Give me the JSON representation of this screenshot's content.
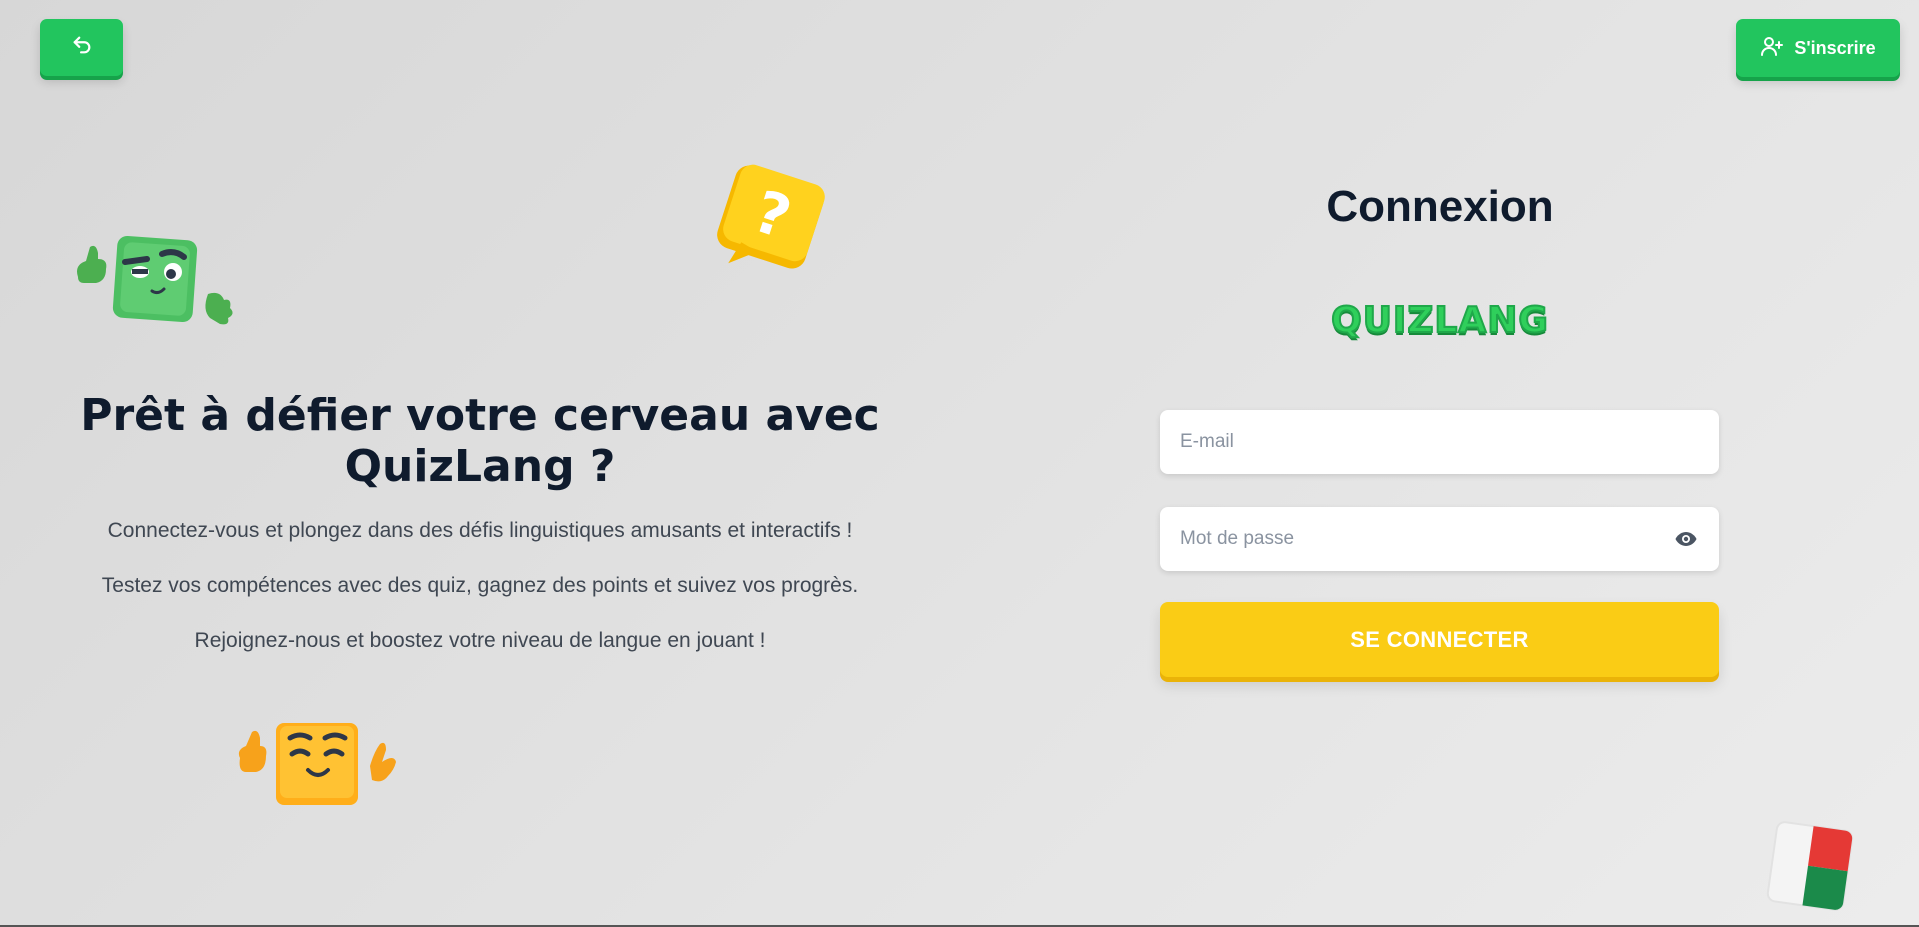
{
  "header": {
    "back_icon": "undo-arrow-icon",
    "signup_label": "S'inscrire",
    "signup_icon": "user-plus-icon"
  },
  "hero": {
    "title": "Prêt à défier votre cerveau avec QuizLang ?",
    "paragraphs": [
      "Connectez-vous et plongez dans des défis linguistiques amusants et interactifs !",
      "Testez vos compétences avec des quiz, gagnez des points et suivez vos progrès.",
      "Rejoignez-nous et boostez votre niveau de langue en jouant !"
    ]
  },
  "login": {
    "title": "Connexion",
    "logo_text": "QUIZLANG",
    "email_placeholder": "E-mail",
    "password_placeholder": "Mot de passe",
    "password_icon": "eye-icon",
    "submit_label": "SE CONNECTER"
  },
  "colors": {
    "accent_green": "#22c55e",
    "accent_yellow": "#facc15",
    "title_dark": "#0f1b2d"
  }
}
